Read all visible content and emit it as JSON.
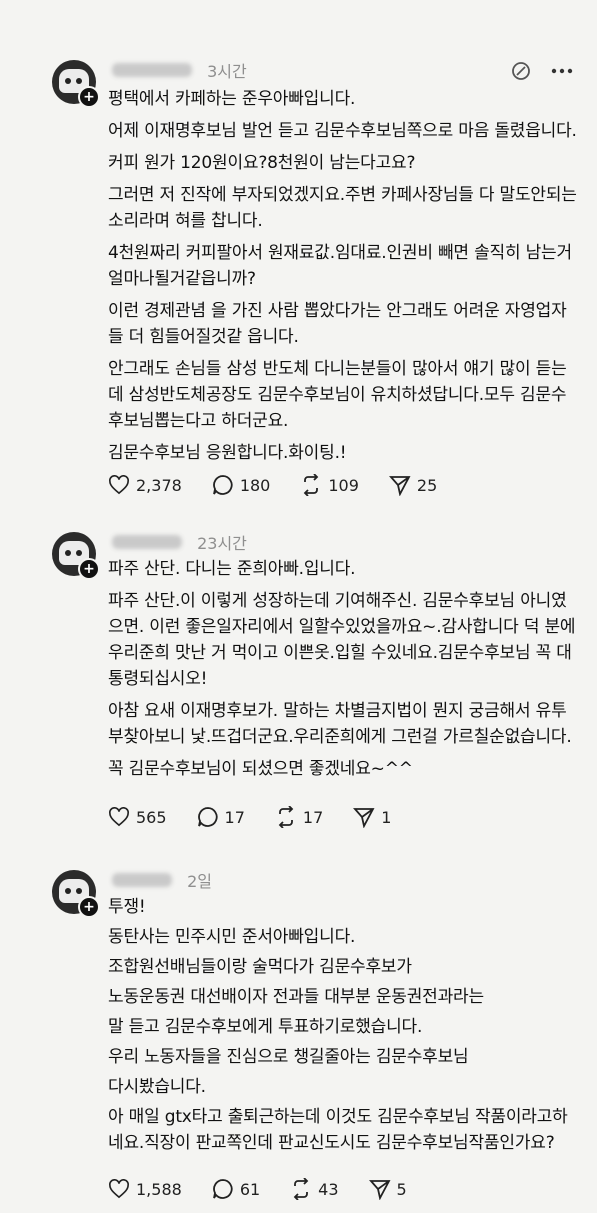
{
  "posts": [
    {
      "time": "3시간",
      "paragraphs": [
        "평택에서 카페하는 준우아빠입니다.",
        "어제 이재명후보님 발언 듣고 김문수후보님쪽으로 마음 돌렸읍니다.",
        "커피 원가 120원이요?8천원이 남는다고요?",
        "그러면 저 진작에 부자되었겠지요.주변 카페사장님들 다 말도안되는소리라며 혀를 찹니다.",
        "4천원짜리 커피팔아서 원재료값.임대료.인권비 빼면 솔직히 남는거 얼마나될거같읍니까?",
        "이런 경제관념 을 가진 사람 뽑았다가는 안그래도 어려운 자영업자들 더 힘들어질것같 읍니다.",
        "안그래도 손님들 삼성 반도체 다니는분들이 많아서 얘기 많이 듣는데 삼성반도체공장도 김문수후보님이 유치하셨답니다.모두 김문수후보님뽑는다고 하더군요.",
        "김문수후보님 응원합니다.화이팅.!"
      ],
      "likes": "2,378",
      "comments": "180",
      "reposts": "109",
      "shares": "25"
    },
    {
      "time": "23시간",
      "paragraphs": [
        "파주 산단. 다니는 준희아빠.입니다.",
        "파주 산단.이 이렇게 성장하는데 기여해주신. 김문수후보님 아니였으면. 이런 좋은일자리에서 일할수있었을까요~.감사합니다 덕 분에 우리준희 맛난 거 먹이고 이쁜옷.입힐 수있네요.김문수후보님 꼭 대통령되십시오!",
        "아참 요새 이재명후보가. 말하는 차별금지법이 뭔지 궁금해서 유투부찾아보니 낯.뜨겁더군요.우리준희에게 그런걸 가르칠순없습니다.",
        "꼭 김문수후보님이 되셨으면 좋겠네요~^^"
      ],
      "likes": "565",
      "comments": "17",
      "reposts": "17",
      "shares": "1"
    },
    {
      "time": "2일",
      "paragraphs": [
        "투쟁!",
        "동탄사는 민주시민 준서아빠입니다.",
        "조합원선배님들이랑 술먹다가 김문수후보가",
        "노동운동권 대선배이자 전과들 대부분 운동권전과라는",
        "말 듣고 김문수후보에게 투표하기로했습니다.",
        "우리 노동자들을 진심으로 챙길줄아는 김문수후보님",
        "다시봤습니다.",
        "아 매일 gtx타고 출퇴근하는데 이것도 김문수후보님 작품이라고하네요.직장이 판교쪽인데 판교신도시도 김문수후보님작품인가요?"
      ],
      "likes": "1,588",
      "comments": "61",
      "reposts": "43",
      "shares": "5"
    }
  ]
}
